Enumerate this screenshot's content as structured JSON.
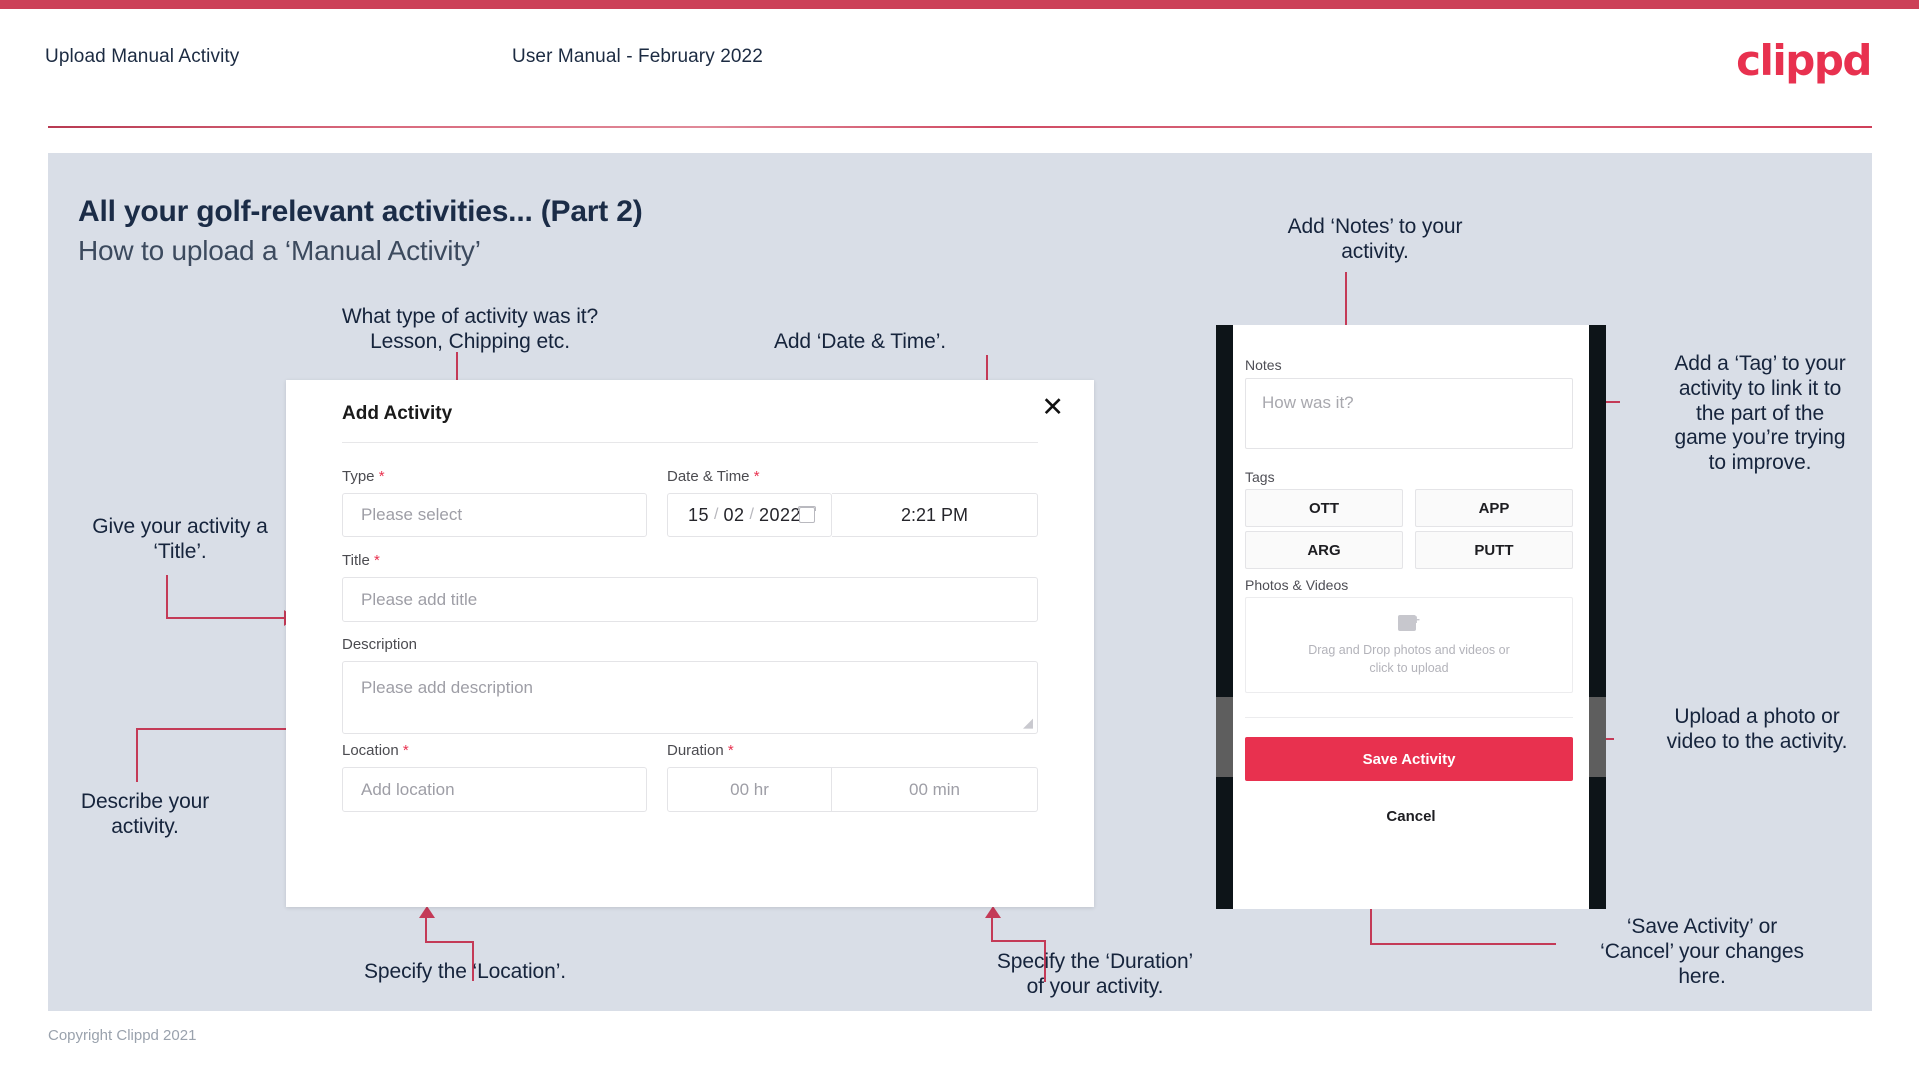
{
  "header": {
    "title": "Upload Manual Activity",
    "subtitle": "User Manual - February 2022",
    "logo": "clippd"
  },
  "slide": {
    "title": "All your golf-relevant activities... (Part 2)",
    "subtitle": "How to upload a ‘Manual Activity’"
  },
  "footer": {
    "copyright": "Copyright Clippd 2021"
  },
  "annotations": {
    "type_note": "What type of activity was it?\nLesson, Chipping etc.",
    "datetime_note": "Add ‘Date & Time’.",
    "title_note": "Give your activity a\n‘Title’.",
    "description_note": "Describe your\nactivity.",
    "location_note": "Specify the ‘Location’.",
    "duration_note": "Specify the ‘Duration’\nof your activity.",
    "notes_note": "Add ‘Notes’ to your\nactivity.",
    "tag_note": "Add a ‘Tag’ to your\nactivity to link it to\nthe part of the\ngame you’re trying\nto improve.",
    "upload_note": "Upload a photo or\nvideo to the activity.",
    "save_note": "‘Save Activity’ or\n‘Cancel’ your changes\nhere."
  },
  "dialog": {
    "title": "Add Activity",
    "close_icon": "close-icon",
    "fields": {
      "type": {
        "label": "Type",
        "required": "*",
        "placeholder": "Please select",
        "chevron_icon": "chevron-down-icon"
      },
      "datetime": {
        "label": "Date & Time",
        "required": "*",
        "day": "15",
        "month": "02",
        "year": "2022",
        "sep": "/",
        "calendar_icon": "calendar-icon",
        "time": "2:21 PM"
      },
      "title": {
        "label": "Title",
        "required": "*",
        "placeholder": "Please add title"
      },
      "description": {
        "label": "Description",
        "required": "",
        "placeholder": "Please add description"
      },
      "location": {
        "label": "Location",
        "required": "*",
        "placeholder": "Add location"
      },
      "duration": {
        "label": "Duration",
        "required": "*",
        "hours_placeholder": "00 hr",
        "minutes_placeholder": "00 min"
      }
    }
  },
  "phone": {
    "notes": {
      "label": "Notes",
      "placeholder": "How was it?"
    },
    "tags": {
      "label": "Tags",
      "items": [
        "OTT",
        "APP",
        "ARG",
        "PUTT"
      ]
    },
    "media": {
      "label": "Photos & Videos",
      "icon": "image-add-icon",
      "dropzone_line1": "Drag and Drop photos and videos or",
      "dropzone_line2": "click to upload"
    },
    "actions": {
      "save": "Save Activity",
      "cancel": "Cancel"
    }
  },
  "colors": {
    "accent": "#e8314f",
    "annotation_arrow": "#c43a57",
    "panel_bg": "#d9dee7",
    "heading": "#1b2c47"
  }
}
